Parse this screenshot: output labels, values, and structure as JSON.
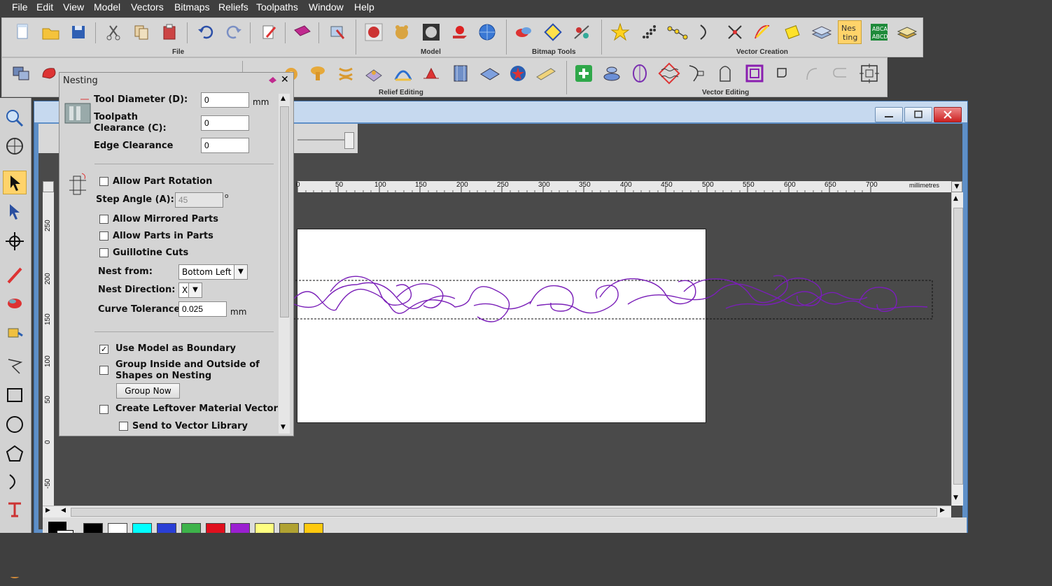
{
  "menu": [
    "File",
    "Edit",
    "View",
    "Model",
    "Vectors",
    "Bitmaps",
    "Reliefs",
    "Toolpaths",
    "Window",
    "Help"
  ],
  "toolbars": {
    "file_caption": "File",
    "model_caption": "Model",
    "bitmap_caption": "Bitmap Tools",
    "vector_creation_caption": "Vector Creation",
    "relief_editing_caption": "Relief Editing",
    "vector_editing_caption": "Vector Editing",
    "nesting_button_label": "Nes ting"
  },
  "dialog": {
    "title": "Nesting",
    "tool_diameter_label": "Tool Diameter (D):",
    "tool_diameter_value": "0",
    "tool_diameter_unit": "mm",
    "toolpath_clearance_label": "Toolpath Clearance (C):",
    "toolpath_clearance_value": "0",
    "edge_clearance_label": "Edge Clearance",
    "edge_clearance_value": "0",
    "allow_rotation_label": "Allow Part Rotation",
    "allow_rotation_checked": false,
    "step_angle_label": "Step Angle (A):",
    "step_angle_value": "45",
    "step_angle_unit": "o",
    "allow_mirrored_label": "Allow Mirrored Parts",
    "allow_parts_in_parts_label": "Allow Parts in Parts",
    "guillotine_label": "Guillotine Cuts",
    "nest_from_label": "Nest from:",
    "nest_from_value": "Bottom Left",
    "nest_direction_label": "Nest Direction:",
    "nest_direction_value": "X",
    "curve_tolerance_label": "Curve Tolerance:",
    "curve_tolerance_value": "0.025",
    "curve_tolerance_unit": "mm",
    "use_model_boundary_label": "Use Model as Boundary",
    "use_model_boundary_checked": true,
    "group_inside_outside_label": "Group Inside and Outside of Shapes on Nesting",
    "group_now_label": "Group Now",
    "create_leftover_label": "Create Leftover Material Vector",
    "send_to_library_label": "Send to Vector Library"
  },
  "ruler": {
    "h_labels": [
      "0",
      "50",
      "100",
      "150",
      "200",
      "250",
      "300",
      "350",
      "400",
      "450",
      "500",
      "550",
      "600",
      "650",
      "700"
    ],
    "unit": "millimetres",
    "v_labels": [
      "250",
      "200",
      "150",
      "100",
      "50",
      "0",
      "-50"
    ]
  },
  "palette": [
    "#000000",
    "#ffffff",
    "#00ffff",
    "#2a3fd6",
    "#3db34a",
    "#e0101e",
    "#9b1fd1",
    "#ffff80",
    "#b0a232",
    "#ffc90e"
  ],
  "colors": {
    "vector": "#7a1fb8"
  }
}
